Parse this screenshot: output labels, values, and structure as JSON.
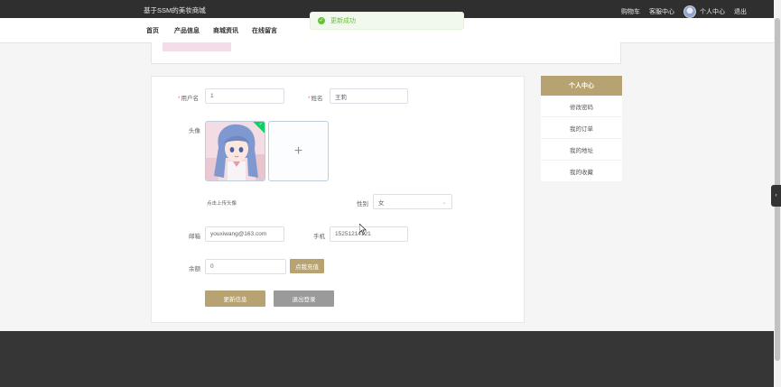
{
  "topbar": {
    "brand": "基于SSM的美妆商城",
    "links": {
      "cart": "购物车",
      "messages": "客服中心",
      "profile": "个人中心",
      "logout": "退出"
    }
  },
  "nav": {
    "items": [
      "首页",
      "产品信息",
      "商城资讯",
      "在线留言"
    ]
  },
  "toast": {
    "text": "更新成功",
    "color": "#67c23a"
  },
  "form": {
    "username_label": "用户名",
    "username_value": "1",
    "name_label": "姓名",
    "name_value": "王莉",
    "avatar_label": "头像",
    "upload_plus": "+",
    "upload_hint": "点击上传头像",
    "gender_label": "性别",
    "gender_value": "女",
    "email_label": "邮箱",
    "email_value": "youxiwang@163.com",
    "phone_label": "手机",
    "phone_value": "15251214121",
    "balance_label": "余额",
    "balance_value": "0",
    "recharge_label": "点我充值",
    "update_label": "更新信息",
    "logout_label": "退出登录"
  },
  "side_menu": {
    "title": "个人中心",
    "items": [
      "修改密码",
      "我的订单",
      "我的地址",
      "我的收藏"
    ]
  },
  "colors": {
    "accent": "#b7a271",
    "topbar": "#2f2f2f",
    "footer": "#363636"
  }
}
